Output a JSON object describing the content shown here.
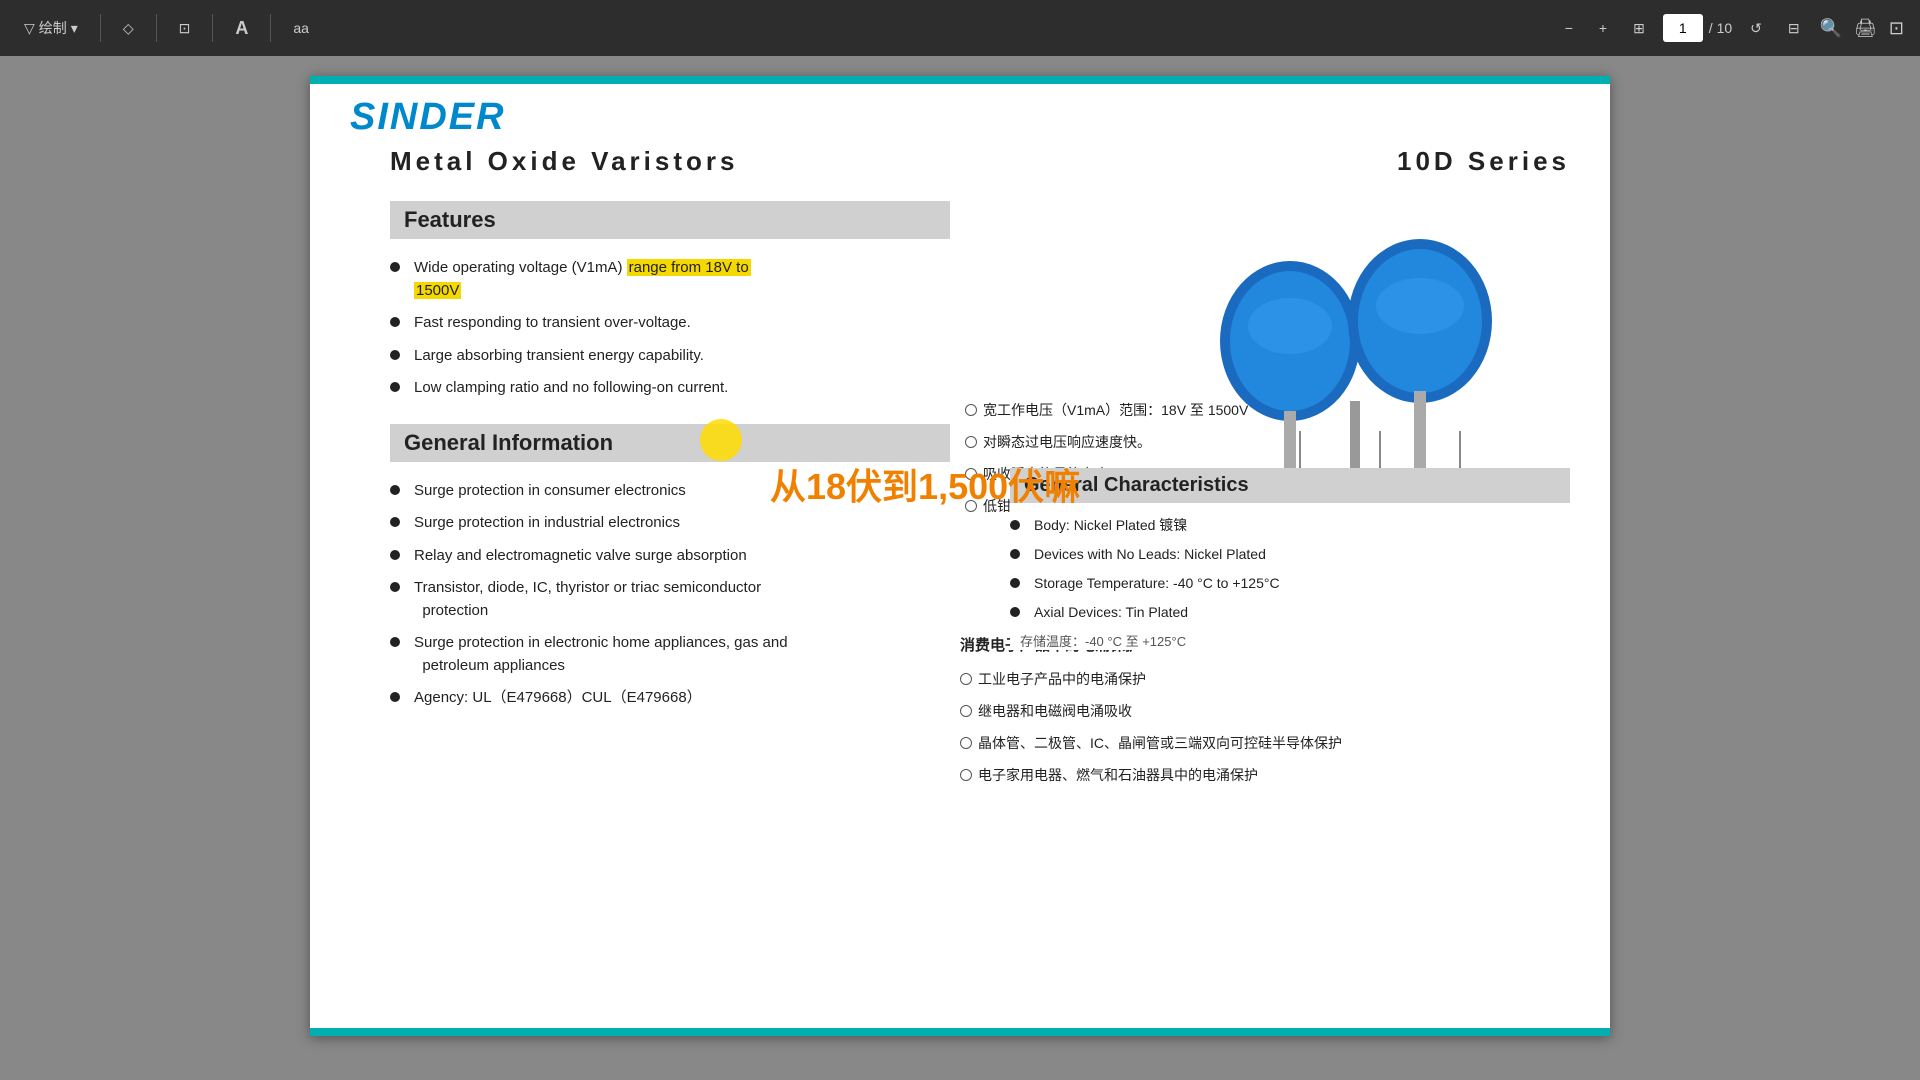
{
  "toolbar": {
    "draw_label": "绘制",
    "erase_label": "◇",
    "layout_label": "⊡",
    "font_label": "A",
    "aa_label": "aа",
    "zoom_out": "−",
    "zoom_in": "+",
    "fit_label": "⊞",
    "page_current": "1",
    "page_total": "/ 10",
    "refresh_label": "↺",
    "layout2_label": "⊟",
    "search_label": "🔍",
    "print_label": "🖨",
    "more_label": "⊡",
    "dropdown_arrow": "▾"
  },
  "doc": {
    "title": "Metal  Oxide  Varistors",
    "series": "10D  Series",
    "logo": "SINDER"
  },
  "features": {
    "section_title": "Features",
    "items": [
      {
        "text_before_highlight": "Wide  operating  voltage  (V1mA)  ",
        "highlight": "range  from  18V  to",
        "text_after_highlight": "",
        "text_line2": "1500V",
        "highlighted": true
      },
      {
        "text": "Fast responding to transient over-voltage.",
        "highlighted": false
      },
      {
        "text": "Large absorbing transient energy capability.",
        "highlighted": false
      },
      {
        "text": "Low clamping ratio and no following-on current.",
        "highlighted": false
      }
    ],
    "chinese_items": [
      "宽工作电压（V1mA）范围：18V 至  1500V",
      "对瞬态过电压响应速度快。",
      "吸收瞬态能量能力大。",
      "低钳位比，无后续电流。"
    ]
  },
  "general_info": {
    "section_title": "General Information",
    "items": [
      "Surge protection in consumer electronics",
      "Surge protection in industrial electronics",
      "Relay and electromagnetic valve surge absorption",
      "Transistor,  diode,  IC,  thyristor or  triac  semiconductor\nprotection",
      "Surge protection in electronic home appliances, gas and\npetroleum appliances",
      "Agency: UL（E479668）CUL（E479668）"
    ],
    "chinese_items": [
      "消费电子产品中的电涌保护",
      "工业电子产品中的电涌保护",
      "继电器和电磁阀电涌吸收",
      "晶体管、二极管、IC、晶闸管或三端双向可控硅半导体保护",
      "电子家用电器、燃气和石油器具中的电涌保护"
    ]
  },
  "general_characteristics": {
    "section_title": "General Characteristics",
    "items": [
      "Body: Nickel Plated    镀镍",
      "Devices with No Leads: Nickel Plated",
      "Storage Temperature: -40 °C to +125°C",
      "Axial Devices: Tin Plated"
    ],
    "chinese_items": [
      "存储温度：-40 °C 至 +125°C"
    ]
  },
  "orange_caption": "从18伏到1,500伏嘛",
  "cursor_highlight_text": "range from 18V to 1500V"
}
